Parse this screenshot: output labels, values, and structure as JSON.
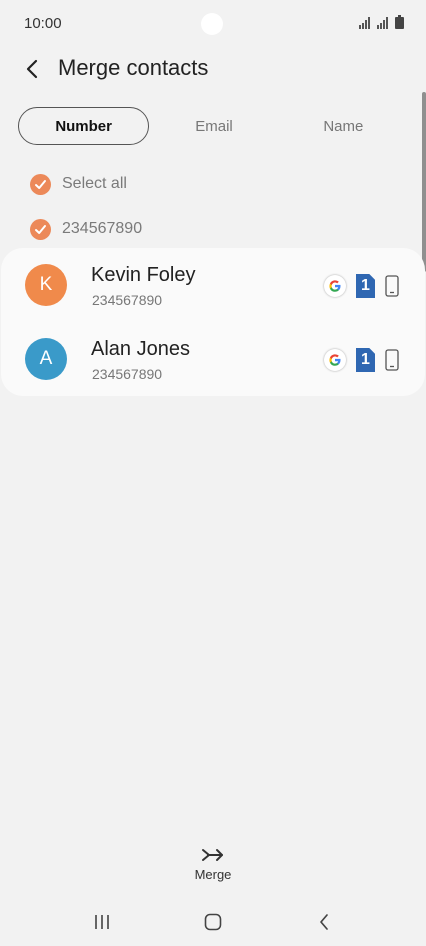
{
  "status_bar": {
    "time": "10:00",
    "icons": [
      "signal-icon",
      "signal-icon",
      "battery-icon"
    ]
  },
  "header": {
    "back_icon": "chevron-left-icon",
    "title": "Merge contacts"
  },
  "tabs": [
    {
      "label": "Number",
      "selected": true
    },
    {
      "label": "Email",
      "selected": false
    },
    {
      "label": "Name",
      "selected": false
    }
  ],
  "select_all": {
    "label": "Select all",
    "checked": true
  },
  "group": {
    "label": "234567890",
    "checked": true
  },
  "contacts": [
    {
      "initial": "K",
      "name": "Kevin Foley",
      "number": "234567890",
      "avatar_color": "#f08a4b",
      "sim_slot": "1",
      "accounts": [
        "google-icon",
        "sim-card-icon",
        "phone-icon"
      ]
    },
    {
      "initial": "A",
      "name": "Alan Jones",
      "number": "234567890",
      "avatar_color": "#3a9ac9",
      "sim_slot": "1",
      "accounts": [
        "google-icon",
        "sim-card-icon",
        "phone-icon"
      ]
    }
  ],
  "bottom_action": {
    "label": "Merge",
    "icon": "merge-icon"
  },
  "nav_bar": {
    "items": [
      "recent-apps-icon",
      "home-icon",
      "back-icon"
    ]
  },
  "colors": {
    "accent": "#ec8959",
    "background": "#f2f2f2",
    "card": "#fafafa",
    "sim": "#2f67b2"
  }
}
